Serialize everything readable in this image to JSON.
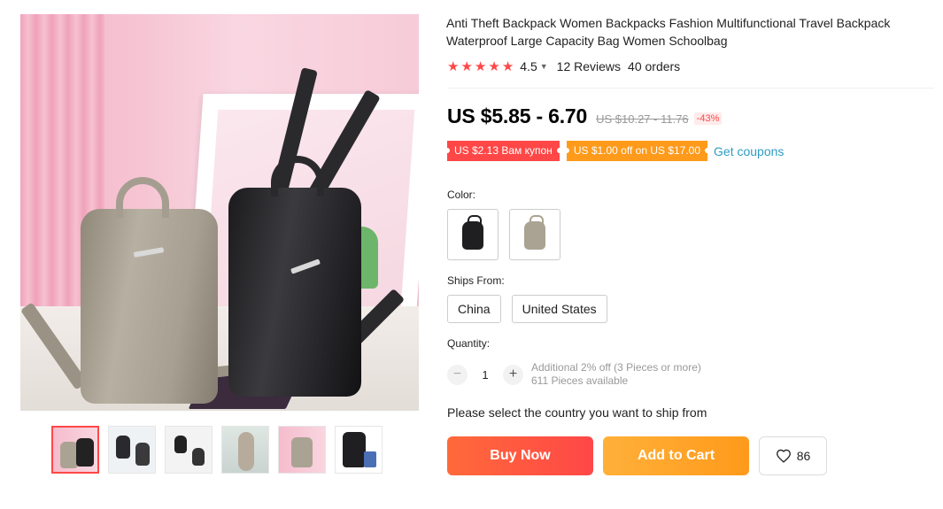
{
  "product": {
    "title": "Anti Theft Backpack Women Backpacks Fashion Multifunctional Travel Backpack Waterproof Large Capacity Bag Women Schoolbag",
    "rating": "4.5",
    "reviews": "12 Reviews",
    "orders": "40 orders",
    "star_color": "#ff4747",
    "stars_filled": 5
  },
  "price": {
    "current": "US $5.85 - 6.70",
    "original": "US $10.27 - 11.76",
    "discount": "-43%"
  },
  "coupons": {
    "coupon1": "US $2.13 Вам купон",
    "coupon2": "US $1.00 off on US $17.00",
    "get_link": "Get coupons"
  },
  "color": {
    "label": "Color:",
    "options": [
      {
        "name": "black",
        "swatch": "#1f1f22"
      },
      {
        "name": "grey",
        "swatch": "#aaa393"
      }
    ]
  },
  "shipping": {
    "label": "Ships From:",
    "options": [
      "China",
      "United States"
    ]
  },
  "quantity": {
    "label": "Quantity:",
    "value": "1",
    "minus_icon": "minus-icon",
    "plus_icon": "plus-icon",
    "note": "Additional 2% off (3 Pieces or more)",
    "available": "611 Pieces available"
  },
  "ship_note": "Please select the country you want to ship from",
  "actions": {
    "buy_now": "Buy Now",
    "add_to_cart": "Add to Cart",
    "wishlist_count": "86",
    "wishlist_icon": "heart-icon"
  },
  "colors": {
    "accent": "#ff4747",
    "cart": "#ff9a1b",
    "link": "#2e9cc3"
  }
}
